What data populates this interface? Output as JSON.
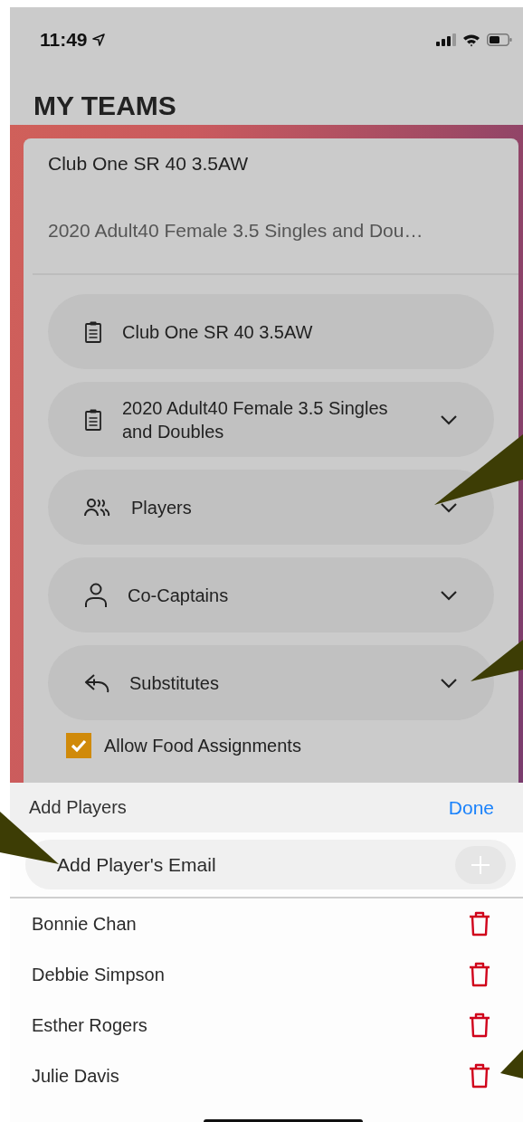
{
  "status_bar": {
    "time": "11:49"
  },
  "title": "MY TEAMS",
  "team": {
    "name": "Club One SR 40 3.5AW",
    "subtitle": "2020 Adult40 Female 3.5 Singles and Dou…",
    "items": [
      {
        "kind": "clipboard",
        "label": "Club One SR 40 3.5AW",
        "expandable": false
      },
      {
        "kind": "clipboard",
        "label": "2020 Adult40 Female 3.5 Singles and Doubles",
        "expandable": true
      },
      {
        "kind": "people",
        "label": "Players",
        "expandable": true
      },
      {
        "kind": "person",
        "label": "Co-Captains",
        "expandable": true
      },
      {
        "kind": "reply",
        "label": "Substitutes",
        "expandable": true
      }
    ],
    "food_option": {
      "label": "Allow Food Assignments",
      "checked": true
    }
  },
  "sheet": {
    "title": "Add Players",
    "done": "Done",
    "email_field": {
      "placeholder": "Add Player's Email"
    },
    "players": [
      {
        "name": "Bonnie Chan"
      },
      {
        "name": "Debbie Simpson"
      },
      {
        "name": "Esther Rogers"
      },
      {
        "name": "Julie Davis"
      }
    ]
  }
}
